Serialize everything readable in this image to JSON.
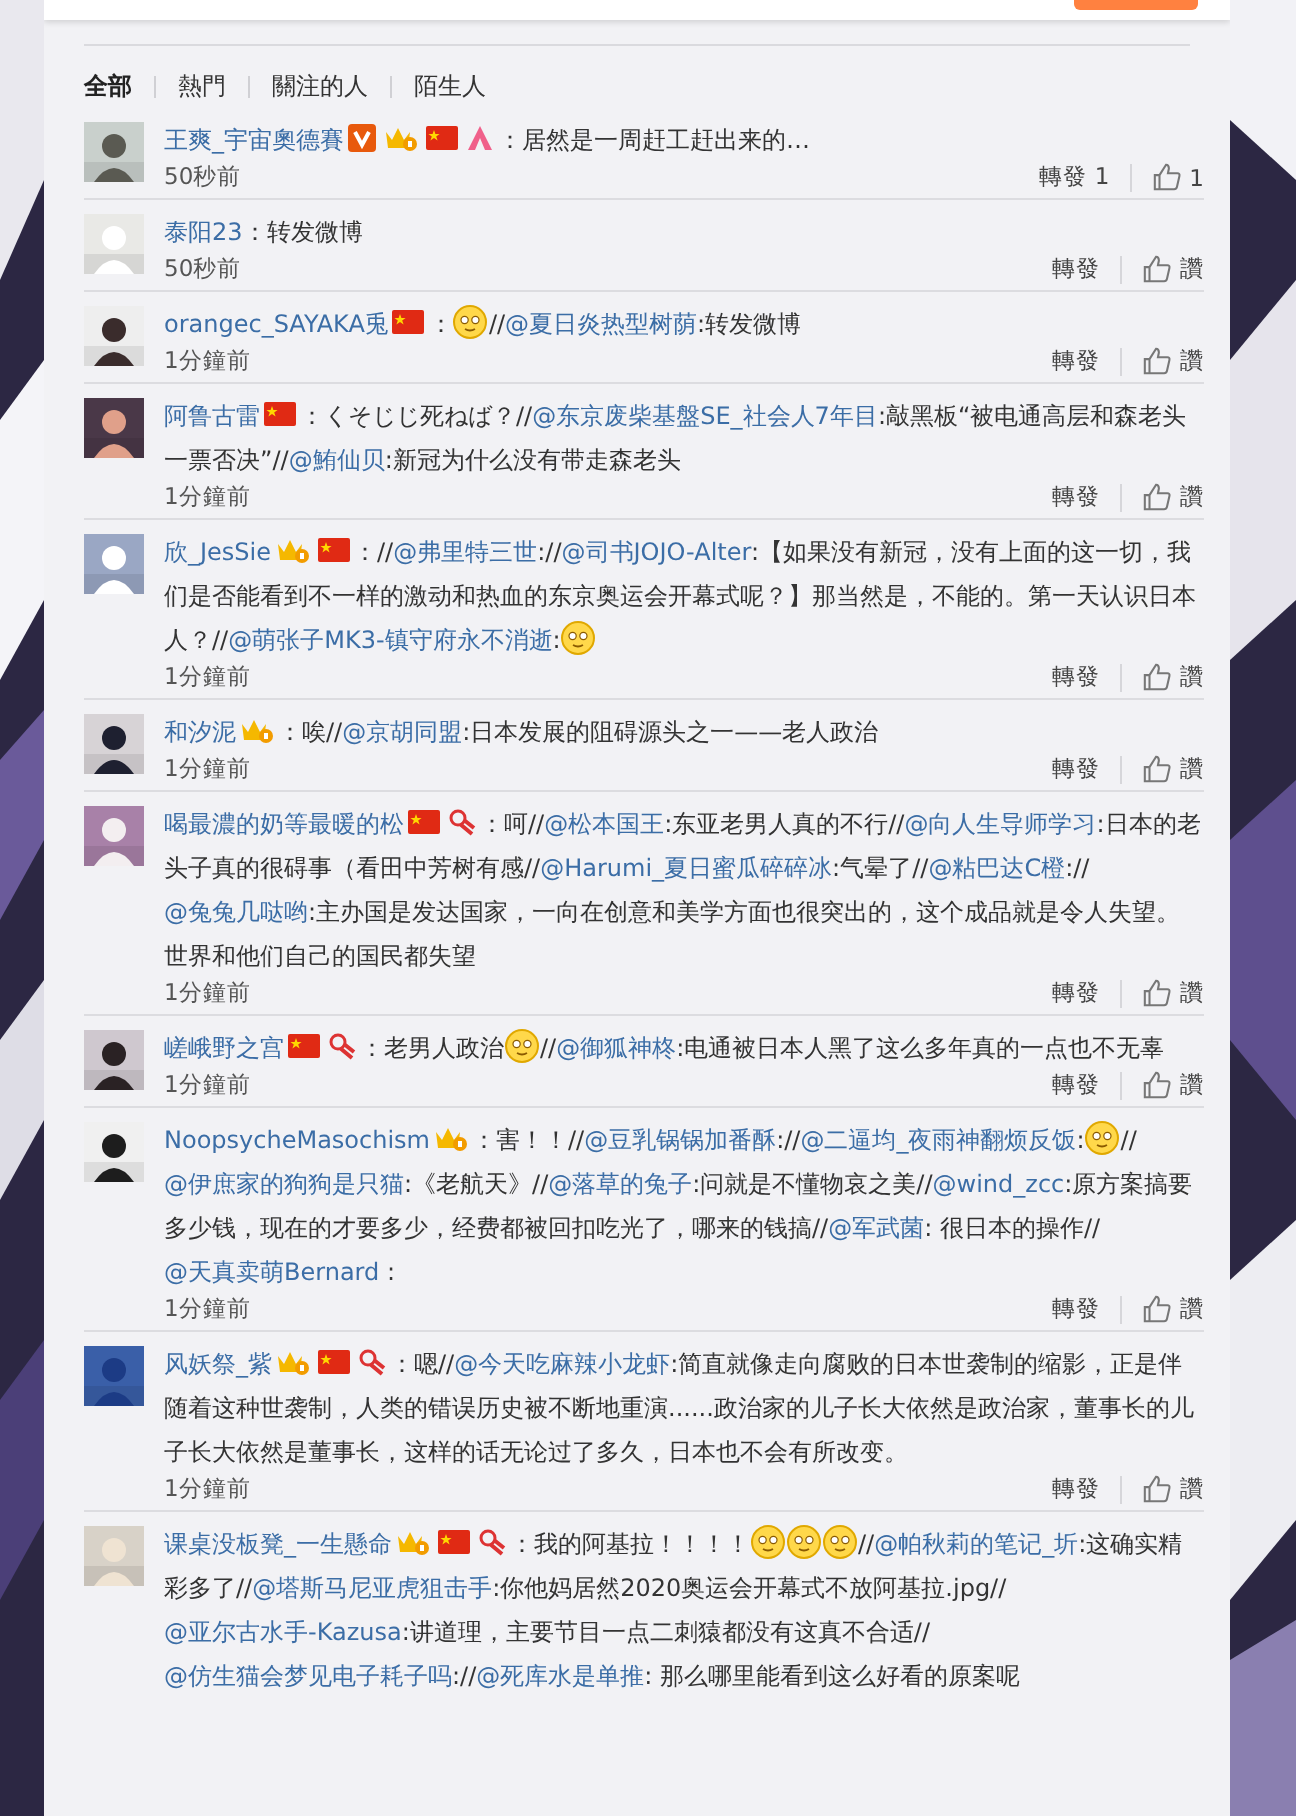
{
  "filter_tabs": [
    {
      "label": "全部",
      "selected": true
    },
    {
      "label": "熱門",
      "selected": false
    },
    {
      "label": "關注的人",
      "selected": false
    },
    {
      "label": "陌生人",
      "selected": false
    }
  ],
  "comments": [
    {
      "user": "王爽_宇宙奧德賽",
      "badges": [
        {
          "kind": "verified"
        },
        {
          "kind": "member"
        },
        {
          "kind": "flag"
        },
        {
          "kind": "triangle"
        }
      ],
      "segments": [
        {
          "kind": "text",
          "text": "：居然是一周赶工赶出来的…"
        }
      ],
      "time": "50秒前",
      "repost": "轉發 1",
      "like": "1"
    },
    {
      "user": "泰阳23",
      "segments": [
        {
          "kind": "text",
          "text": "：转发微博"
        }
      ],
      "time": "50秒前",
      "repost": "轉發",
      "like": "讚"
    },
    {
      "user": "orangec_SAYAKA兎",
      "badges": [
        {
          "kind": "flag"
        }
      ],
      "segments": [
        {
          "kind": "text",
          "text": "："
        },
        {
          "kind": "emoji"
        },
        {
          "kind": "text",
          "text": "//"
        },
        {
          "kind": "link",
          "text": "@夏日炎热型树荫"
        },
        {
          "kind": "text",
          "text": ":转发微博"
        }
      ],
      "time": "1分鐘前",
      "repost": "轉發",
      "like": "讚"
    },
    {
      "user": "阿鲁古雷",
      "badges": [
        {
          "kind": "flag"
        }
      ],
      "segments": [
        {
          "kind": "text",
          "text": "：くそじじ死ねば？//"
        },
        {
          "kind": "link",
          "text": "@东京废柴基盤SE_社会人7年目"
        },
        {
          "kind": "text",
          "text": ":敲黑板“被电通高层和森老头一票否决”//"
        },
        {
          "kind": "link",
          "text": "@鮪仙贝"
        },
        {
          "kind": "text",
          "text": ":新冠为什么没有带走森老头"
        }
      ],
      "time": "1分鐘前",
      "repost": "轉發",
      "like": "讚"
    },
    {
      "user": "欣_JesSie",
      "badges": [
        {
          "kind": "member"
        },
        {
          "kind": "flag"
        }
      ],
      "segments": [
        {
          "kind": "text",
          "text": "：//"
        },
        {
          "kind": "link",
          "text": "@弗里特三世"
        },
        {
          "kind": "text",
          "text": "://"
        },
        {
          "kind": "link",
          "text": "@司书JOJO-Alter"
        },
        {
          "kind": "text",
          "text": ":【如果没有新冠，没有上面的这一切，我们是否能看到不一样的激动和热血的东京奥运会开幕式呢？】那当然是，不能的。第一天认识日本人？//"
        },
        {
          "kind": "link",
          "text": "@萌张子MK3-镇守府永不消逝"
        },
        {
          "kind": "text",
          "text": ":"
        },
        {
          "kind": "emoji"
        }
      ],
      "time": "1分鐘前",
      "repost": "轉發",
      "like": "讚"
    },
    {
      "user": "和汐泥",
      "badges": [
        {
          "kind": "member"
        }
      ],
      "segments": [
        {
          "kind": "text",
          "text": "：唉//"
        },
        {
          "kind": "link",
          "text": "@京胡同盟"
        },
        {
          "kind": "text",
          "text": ":日本发展的阻碍源头之一——老人政治"
        }
      ],
      "time": "1分鐘前",
      "repost": "轉發",
      "like": "讚"
    },
    {
      "user": "喝最濃的奶等最暖的松",
      "badges": [
        {
          "kind": "flag"
        },
        {
          "kind": "ribbon"
        }
      ],
      "segments": [
        {
          "kind": "text",
          "text": "：呵//"
        },
        {
          "kind": "link",
          "text": "@松本国王"
        },
        {
          "kind": "text",
          "text": ":东亚老男人真的不行//"
        },
        {
          "kind": "link",
          "text": "@向人生导师学习"
        },
        {
          "kind": "text",
          "text": ":日本的老头子真的很碍事（看田中芳树有感//"
        },
        {
          "kind": "link",
          "text": "@Harumi_夏日蜜瓜碎碎冰"
        },
        {
          "kind": "text",
          "text": ":气晕了//"
        },
        {
          "kind": "link",
          "text": "@粘巴达C橙"
        },
        {
          "kind": "text",
          "text": "://"
        },
        {
          "kind": "link",
          "text": "@兔兔几哒哟"
        },
        {
          "kind": "text",
          "text": ":主办国是发达国家，一向在创意和美学方面也很突出的，这个成品就是令人失望。世界和他们自己的国民都失望"
        }
      ],
      "time": "1分鐘前",
      "repost": "轉發",
      "like": "讚"
    },
    {
      "user": "嵯峨野之宫",
      "badges": [
        {
          "kind": "flag"
        },
        {
          "kind": "ribbon"
        }
      ],
      "segments": [
        {
          "kind": "text",
          "text": "：老男人政治"
        },
        {
          "kind": "emoji"
        },
        {
          "kind": "text",
          "text": "//"
        },
        {
          "kind": "link",
          "text": "@御狐神柊"
        },
        {
          "kind": "text",
          "text": ":电通被日本人黑了这么多年真的一点也不无辜"
        }
      ],
      "time": "1分鐘前",
      "repost": "轉發",
      "like": "讚"
    },
    {
      "user": "NoopsycheMasochism",
      "badges": [
        {
          "kind": "member"
        }
      ],
      "segments": [
        {
          "kind": "text",
          "text": "：害！！//"
        },
        {
          "kind": "link",
          "text": "@豆乳锅锅加番酥"
        },
        {
          "kind": "text",
          "text": "://"
        },
        {
          "kind": "link",
          "text": "@二逼均_夜雨神翻烦反饭"
        },
        {
          "kind": "text",
          "text": ":"
        },
        {
          "kind": "emoji"
        },
        {
          "kind": "text",
          "text": "//"
        },
        {
          "kind": "link",
          "text": "@伊庶家的狗狗是只猫"
        },
        {
          "kind": "text",
          "text": ":《老航天》//"
        },
        {
          "kind": "link",
          "text": "@落草的兔子"
        },
        {
          "kind": "text",
          "text": ":问就是不懂物哀之美//"
        },
        {
          "kind": "link",
          "text": "@wind_zcc"
        },
        {
          "kind": "text",
          "text": ":原方案搞要多少钱，现在的才要多少，经费都被回扣吃光了，哪来的钱搞//"
        },
        {
          "kind": "link",
          "text": "@军武菌"
        },
        {
          "kind": "text",
          "text": ": 很日本的操作//"
        },
        {
          "kind": "link",
          "text": "@天真卖萌Bernard"
        },
        {
          "kind": "text",
          "text": " :"
        }
      ],
      "time": "1分鐘前",
      "repost": "轉發",
      "like": "讚"
    },
    {
      "user": "风妖祭_紫",
      "badges": [
        {
          "kind": "member"
        },
        {
          "kind": "flag"
        },
        {
          "kind": "ribbon"
        }
      ],
      "segments": [
        {
          "kind": "text",
          "text": "：嗯//"
        },
        {
          "kind": "link",
          "text": "@今天吃麻辣小龙虾"
        },
        {
          "kind": "text",
          "text": ":简直就像走向腐败的日本世袭制的缩影，正是伴随着这种世袭制，人类的错误历史被不断地重演......政治家的儿子长大依然是政治家，董事长的儿子长大依然是董事长，这样的话无论过了多久，日本也不会有所改变。"
        }
      ],
      "time": "1分鐘前",
      "repost": "轉發",
      "like": "讚"
    },
    {
      "user": "课桌没板凳_一生懸命",
      "badges": [
        {
          "kind": "member"
        },
        {
          "kind": "flag"
        },
        {
          "kind": "ribbon"
        }
      ],
      "segments": [
        {
          "kind": "text",
          "text": "：我的阿基拉！！！！"
        },
        {
          "kind": "emoji"
        },
        {
          "kind": "emoji"
        },
        {
          "kind": "emoji"
        },
        {
          "kind": "text",
          "text": "//"
        },
        {
          "kind": "link",
          "text": "@帕秋莉的笔记_圻"
        },
        {
          "kind": "text",
          "text": ":这确实精彩多了//"
        },
        {
          "kind": "link",
          "text": "@塔斯马尼亚虎狙击手"
        },
        {
          "kind": "text",
          "text": ":你他妈居然2020奥运会开幕式不放阿基拉.jpg//"
        },
        {
          "kind": "link",
          "text": "@亚尔古水手-Kazusa"
        },
        {
          "kind": "text",
          "text": ":讲道理，主要节目一点二刺猿都没有这真不合适//"
        },
        {
          "kind": "link",
          "text": "@仿生猫会梦见电子耗子吗"
        },
        {
          "kind": "text",
          "text": "://"
        },
        {
          "kind": "link",
          "text": "@死库水是单推"
        },
        {
          "kind": "text",
          "text": ": 那么哪里能看到这么好看的原案呢"
        }
      ]
    }
  ]
}
